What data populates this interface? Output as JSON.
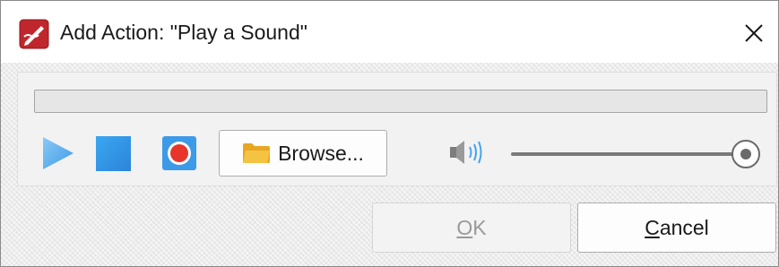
{
  "window": {
    "title": "Add Action: \"Play a Sound\"",
    "app_icon": "pdf-editor-icon",
    "close_icon": "close-icon"
  },
  "player": {
    "progress": 0,
    "play_icon": "play-icon",
    "stop_icon": "stop-icon",
    "record_icon": "record-icon",
    "browse": {
      "icon": "folder-icon",
      "label": "Browse..."
    },
    "volume_icon": "speaker-icon",
    "volume": 1.0
  },
  "buttons": {
    "ok": {
      "accel": "O",
      "rest": "K",
      "enabled": false
    },
    "cancel": {
      "accel": "C",
      "rest": "ancel",
      "enabled": true
    }
  },
  "colors": {
    "accent_blue": "#3c9be8",
    "record_red": "#e8352b",
    "folder_yellow": "#f5c342",
    "brand_red": "#c0272d"
  }
}
